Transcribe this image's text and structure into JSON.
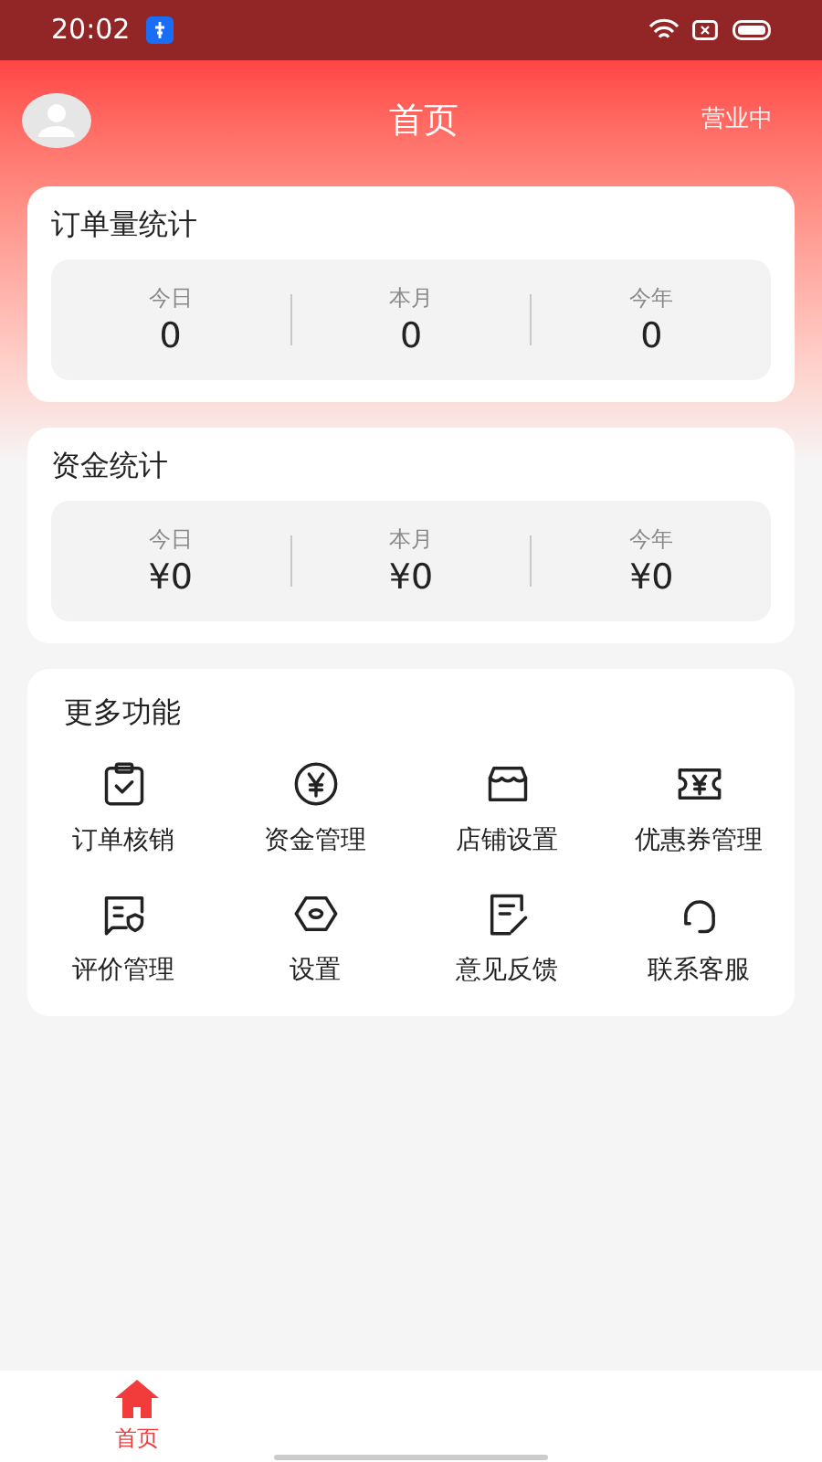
{
  "status_bar": {
    "time": "20:02"
  },
  "header": {
    "title": "首页",
    "status": "营业中"
  },
  "stats": [
    {
      "title": "订单量统计",
      "items": [
        {
          "label": "今日",
          "value": "0"
        },
        {
          "label": "本月",
          "value": "0"
        },
        {
          "label": "今年",
          "value": "0"
        }
      ]
    },
    {
      "title": "资金统计",
      "items": [
        {
          "label": "今日",
          "value": "¥0"
        },
        {
          "label": "本月",
          "value": "¥0"
        },
        {
          "label": "今年",
          "value": "¥0"
        }
      ]
    }
  ],
  "features": {
    "title": "更多功能",
    "items": [
      {
        "label": "订单核销"
      },
      {
        "label": "资金管理"
      },
      {
        "label": "店铺设置"
      },
      {
        "label": "优惠券管理"
      },
      {
        "label": "评价管理"
      },
      {
        "label": "设置"
      },
      {
        "label": "意见反馈"
      },
      {
        "label": "联系客服"
      }
    ]
  },
  "bottom_nav": [
    {
      "label": "首页",
      "selected": true
    }
  ]
}
